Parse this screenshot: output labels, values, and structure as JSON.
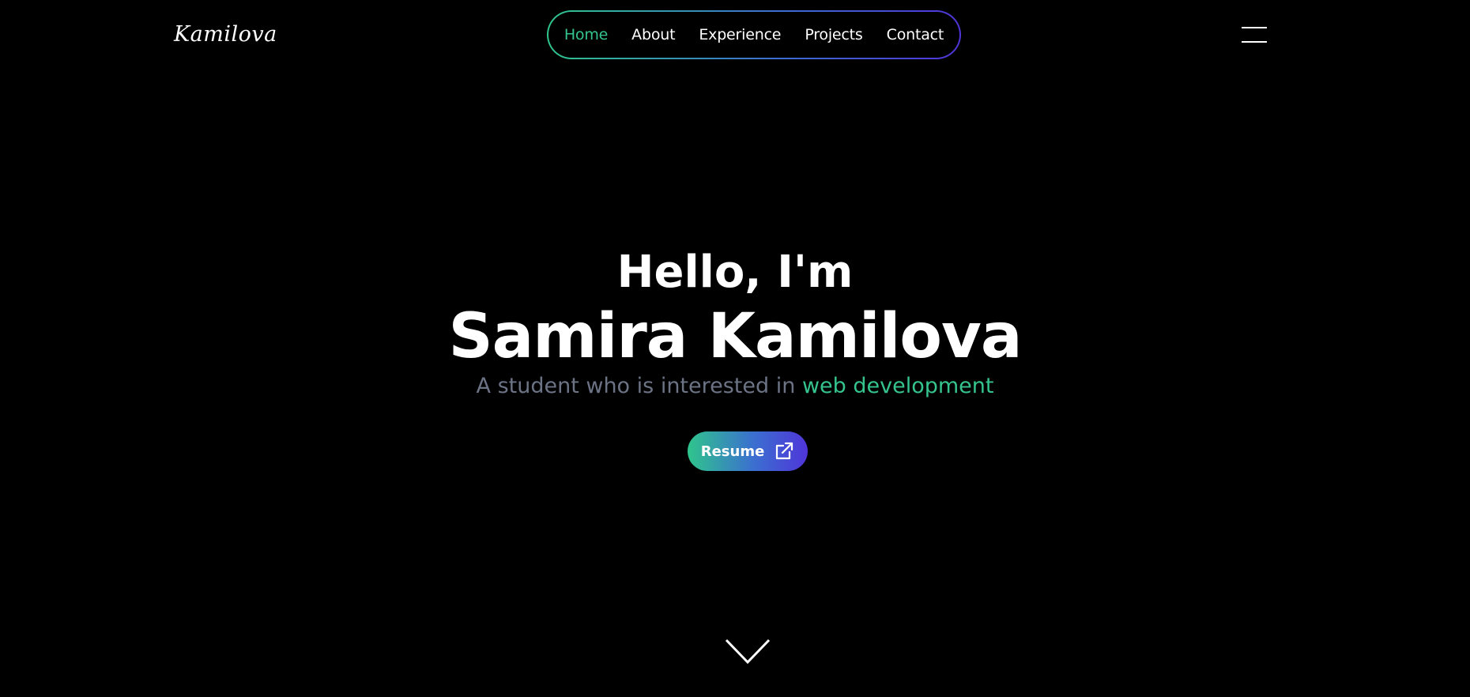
{
  "logo": {
    "text": "Kamilova"
  },
  "nav": {
    "items": [
      {
        "label": "Home",
        "active": true
      },
      {
        "label": "About",
        "active": false
      },
      {
        "label": "Experience",
        "active": false
      },
      {
        "label": "Projects",
        "active": false
      },
      {
        "label": "Contact",
        "active": false
      }
    ]
  },
  "header": {
    "menu_icon": "hamburger-icon"
  },
  "hero": {
    "greeting": "Hello, I'm",
    "name": "Samira Kamilova",
    "tagline_prefix": "A student who is interested in ",
    "tagline_accent": "web development",
    "resume_label": "Resume",
    "resume_icon": "external-link-icon",
    "scroll_icon": "chevron-down-icon"
  },
  "colors": {
    "background": "#000000",
    "accent_green": "#35c48e",
    "accent_purple": "#4f35d9",
    "muted_text": "#6b7385",
    "text": "#ffffff"
  }
}
